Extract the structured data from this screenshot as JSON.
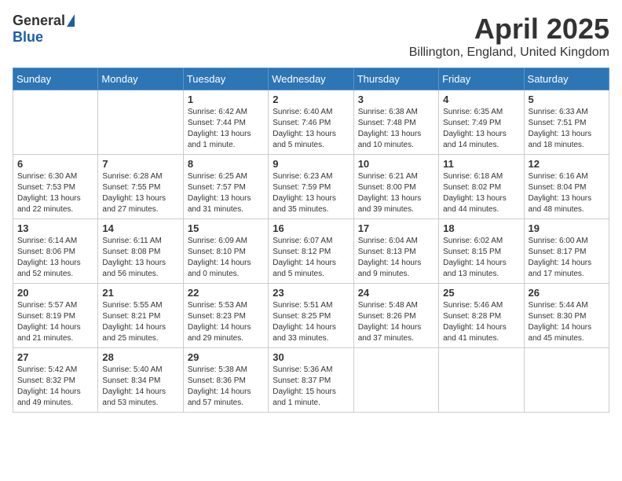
{
  "header": {
    "logo_general": "General",
    "logo_blue": "Blue",
    "month_title": "April 2025",
    "location": "Billington, England, United Kingdom"
  },
  "days_of_week": [
    "Sunday",
    "Monday",
    "Tuesday",
    "Wednesday",
    "Thursday",
    "Friday",
    "Saturday"
  ],
  "weeks": [
    [
      {
        "day": "",
        "info": ""
      },
      {
        "day": "",
        "info": ""
      },
      {
        "day": "1",
        "info": "Sunrise: 6:42 AM\nSunset: 7:44 PM\nDaylight: 13 hours and 1 minute."
      },
      {
        "day": "2",
        "info": "Sunrise: 6:40 AM\nSunset: 7:46 PM\nDaylight: 13 hours and 5 minutes."
      },
      {
        "day": "3",
        "info": "Sunrise: 6:38 AM\nSunset: 7:48 PM\nDaylight: 13 hours and 10 minutes."
      },
      {
        "day": "4",
        "info": "Sunrise: 6:35 AM\nSunset: 7:49 PM\nDaylight: 13 hours and 14 minutes."
      },
      {
        "day": "5",
        "info": "Sunrise: 6:33 AM\nSunset: 7:51 PM\nDaylight: 13 hours and 18 minutes."
      }
    ],
    [
      {
        "day": "6",
        "info": "Sunrise: 6:30 AM\nSunset: 7:53 PM\nDaylight: 13 hours and 22 minutes."
      },
      {
        "day": "7",
        "info": "Sunrise: 6:28 AM\nSunset: 7:55 PM\nDaylight: 13 hours and 27 minutes."
      },
      {
        "day": "8",
        "info": "Sunrise: 6:25 AM\nSunset: 7:57 PM\nDaylight: 13 hours and 31 minutes."
      },
      {
        "day": "9",
        "info": "Sunrise: 6:23 AM\nSunset: 7:59 PM\nDaylight: 13 hours and 35 minutes."
      },
      {
        "day": "10",
        "info": "Sunrise: 6:21 AM\nSunset: 8:00 PM\nDaylight: 13 hours and 39 minutes."
      },
      {
        "day": "11",
        "info": "Sunrise: 6:18 AM\nSunset: 8:02 PM\nDaylight: 13 hours and 44 minutes."
      },
      {
        "day": "12",
        "info": "Sunrise: 6:16 AM\nSunset: 8:04 PM\nDaylight: 13 hours and 48 minutes."
      }
    ],
    [
      {
        "day": "13",
        "info": "Sunrise: 6:14 AM\nSunset: 8:06 PM\nDaylight: 13 hours and 52 minutes."
      },
      {
        "day": "14",
        "info": "Sunrise: 6:11 AM\nSunset: 8:08 PM\nDaylight: 13 hours and 56 minutes."
      },
      {
        "day": "15",
        "info": "Sunrise: 6:09 AM\nSunset: 8:10 PM\nDaylight: 14 hours and 0 minutes."
      },
      {
        "day": "16",
        "info": "Sunrise: 6:07 AM\nSunset: 8:12 PM\nDaylight: 14 hours and 5 minutes."
      },
      {
        "day": "17",
        "info": "Sunrise: 6:04 AM\nSunset: 8:13 PM\nDaylight: 14 hours and 9 minutes."
      },
      {
        "day": "18",
        "info": "Sunrise: 6:02 AM\nSunset: 8:15 PM\nDaylight: 14 hours and 13 minutes."
      },
      {
        "day": "19",
        "info": "Sunrise: 6:00 AM\nSunset: 8:17 PM\nDaylight: 14 hours and 17 minutes."
      }
    ],
    [
      {
        "day": "20",
        "info": "Sunrise: 5:57 AM\nSunset: 8:19 PM\nDaylight: 14 hours and 21 minutes."
      },
      {
        "day": "21",
        "info": "Sunrise: 5:55 AM\nSunset: 8:21 PM\nDaylight: 14 hours and 25 minutes."
      },
      {
        "day": "22",
        "info": "Sunrise: 5:53 AM\nSunset: 8:23 PM\nDaylight: 14 hours and 29 minutes."
      },
      {
        "day": "23",
        "info": "Sunrise: 5:51 AM\nSunset: 8:25 PM\nDaylight: 14 hours and 33 minutes."
      },
      {
        "day": "24",
        "info": "Sunrise: 5:48 AM\nSunset: 8:26 PM\nDaylight: 14 hours and 37 minutes."
      },
      {
        "day": "25",
        "info": "Sunrise: 5:46 AM\nSunset: 8:28 PM\nDaylight: 14 hours and 41 minutes."
      },
      {
        "day": "26",
        "info": "Sunrise: 5:44 AM\nSunset: 8:30 PM\nDaylight: 14 hours and 45 minutes."
      }
    ],
    [
      {
        "day": "27",
        "info": "Sunrise: 5:42 AM\nSunset: 8:32 PM\nDaylight: 14 hours and 49 minutes."
      },
      {
        "day": "28",
        "info": "Sunrise: 5:40 AM\nSunset: 8:34 PM\nDaylight: 14 hours and 53 minutes."
      },
      {
        "day": "29",
        "info": "Sunrise: 5:38 AM\nSunset: 8:36 PM\nDaylight: 14 hours and 57 minutes."
      },
      {
        "day": "30",
        "info": "Sunrise: 5:36 AM\nSunset: 8:37 PM\nDaylight: 15 hours and 1 minute."
      },
      {
        "day": "",
        "info": ""
      },
      {
        "day": "",
        "info": ""
      },
      {
        "day": "",
        "info": ""
      }
    ]
  ]
}
